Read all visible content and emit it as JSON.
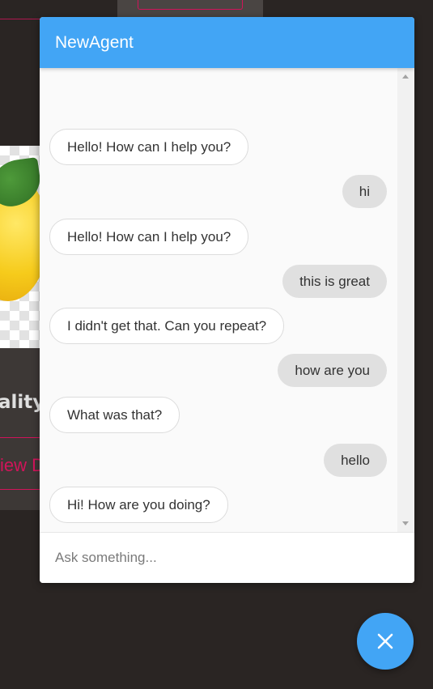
{
  "background": {
    "card_title_fragment": "ality",
    "card_link_fragment": "iew D"
  },
  "chat": {
    "title": "NewAgent",
    "input_placeholder": "Ask something...",
    "messages": [
      {
        "from": "bot",
        "text": "Hello! How can I help you?"
      },
      {
        "from": "user",
        "text": "hi"
      },
      {
        "from": "bot",
        "text": "Hello! How can I help you?"
      },
      {
        "from": "user",
        "text": "this is great"
      },
      {
        "from": "bot",
        "text": "I didn't get that. Can you repeat?"
      },
      {
        "from": "user",
        "text": "how are you"
      },
      {
        "from": "bot",
        "text": "What was that?"
      },
      {
        "from": "user",
        "text": "hello"
      },
      {
        "from": "bot",
        "text": "Hi! How are you doing?"
      }
    ],
    "close_button_icon": "close-icon"
  },
  "colors": {
    "accent": "#42a5f5",
    "page_background": "#2a2523",
    "bot_bubble": "#ffffff",
    "user_bubble": "#e0e0e0",
    "brand_pink": "#d1145a"
  }
}
